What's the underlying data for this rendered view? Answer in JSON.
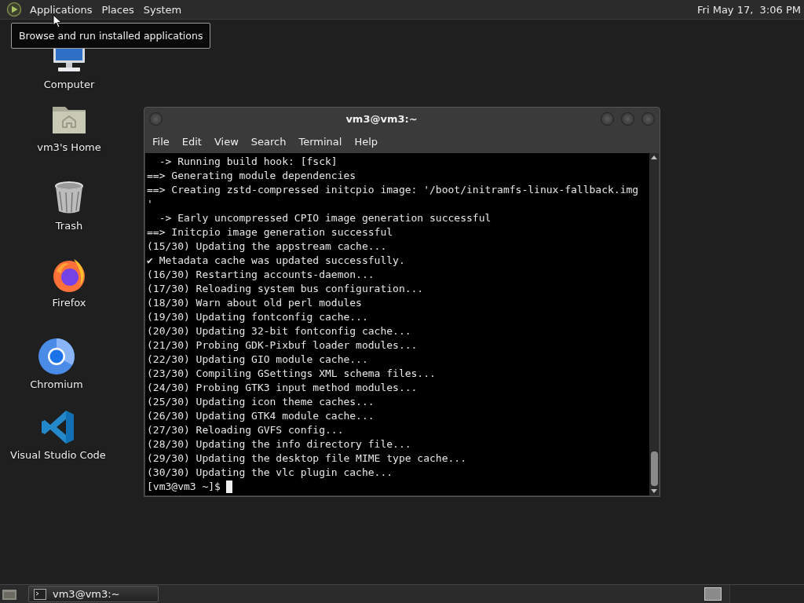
{
  "top_panel": {
    "menus": [
      {
        "label": "Applications"
      },
      {
        "label": "Places"
      },
      {
        "label": "System"
      }
    ],
    "clock": "Fri May 17,  3:06 PM"
  },
  "tooltip": {
    "text": "Browse and run installed applications"
  },
  "desktop_icons": [
    {
      "label": "Computer",
      "kind": "computer"
    },
    {
      "label": "vm3's Home",
      "kind": "home"
    },
    {
      "label": "Trash",
      "kind": "trash"
    },
    {
      "label": "Firefox",
      "kind": "firefox"
    },
    {
      "label": "Chromium",
      "kind": "chromium"
    },
    {
      "label": "Visual Studio Code",
      "kind": "vscode"
    }
  ],
  "terminal": {
    "title": "vm3@vm3:~",
    "menu": [
      "File",
      "Edit",
      "View",
      "Search",
      "Terminal",
      "Help"
    ],
    "lines": [
      "  -> Running build hook: [fsck]",
      "==> Generating module dependencies",
      "==> Creating zstd-compressed initcpio image: '/boot/initramfs-linux-fallback.img",
      "'",
      "  -> Early uncompressed CPIO image generation successful",
      "==> Initcpio image generation successful",
      "(15/30) Updating the appstream cache...",
      "✔ Metadata cache was updated successfully.",
      "(16/30) Restarting accounts-daemon...",
      "(17/30) Reloading system bus configuration...",
      "(18/30) Warn about old perl modules",
      "(19/30) Updating fontconfig cache...",
      "(20/30) Updating 32-bit fontconfig cache...",
      "(21/30) Probing GDK-Pixbuf loader modules...",
      "(22/30) Updating GIO module cache...",
      "(23/30) Compiling GSettings XML schema files...",
      "(24/30) Probing GTK3 input method modules...",
      "(25/30) Updating icon theme caches...",
      "(26/30) Updating GTK4 module cache...",
      "(27/30) Reloading GVFS config...",
      "(28/30) Updating the info directory file...",
      "(29/30) Updating the desktop file MIME type cache...",
      "(30/30) Updating the vlc plugin cache..."
    ],
    "prompt": "[vm3@vm3 ~]$"
  },
  "taskbar": {
    "items": [
      {
        "label": "vm3@vm3:~",
        "selected": false
      }
    ]
  }
}
